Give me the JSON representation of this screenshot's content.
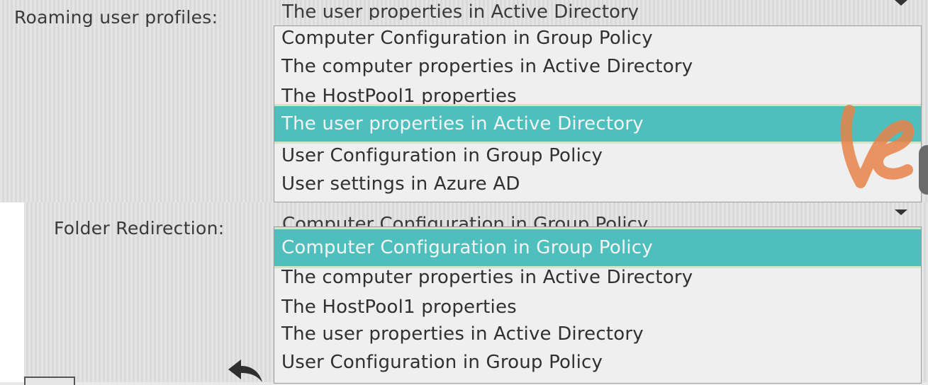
{
  "roaming": {
    "label": "Roaming user profiles:",
    "current_value": "The user properties in Active Directory",
    "options": [
      "Computer Configuration in Group Policy",
      "The computer properties in Active Directory",
      "The HostPool1 properties",
      "The user properties in Active Directory",
      "User Configuration in Group Policy",
      "User settings in Azure AD"
    ],
    "selected_option": "The user properties in Active Directory"
  },
  "folder": {
    "label": "Folder Redirection:",
    "current_value": "Computer Configuration in Group Policy",
    "options": [
      "Computer Configuration in Group Policy",
      "The computer properties in Active Directory",
      "The HostPool1 properties",
      "The user properties in Active Directory",
      "User Configuration in Group Policy"
    ],
    "selected_option": "Computer Configuration in Group Policy"
  },
  "colors": {
    "highlight": "#4fbfbe",
    "highlight_border": "#cfe7c9",
    "logo": "#e8834a"
  },
  "icons": [
    "dropdown-arrow-icon",
    "back-arrow-icon",
    "watermark-logo-icon"
  ]
}
